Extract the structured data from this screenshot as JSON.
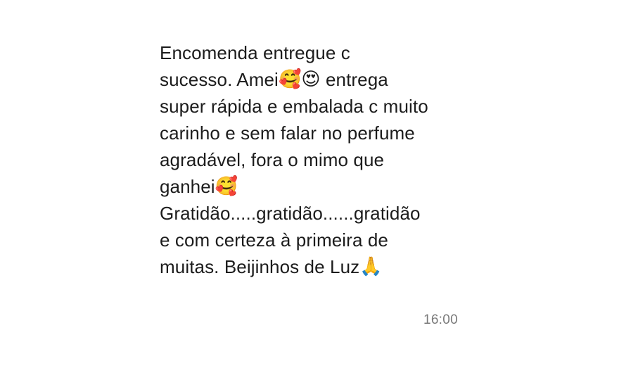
{
  "message": {
    "lines": [
      {
        "text": "Encomenda entregue c",
        "emojis": []
      },
      {
        "text": "sucesso. Amei",
        "emojis": [
          "🥰",
          "😍"
        ],
        "suffix": " entrega"
      },
      {
        "text": "super rápida e embalada c muito",
        "emojis": []
      },
      {
        "text": "carinho e sem falar no perfume",
        "emojis": []
      },
      {
        "text": "agradável, fora o mimo que",
        "emojis": []
      },
      {
        "text": "ganhei",
        "emojis": [
          "🥰"
        ]
      },
      {
        "text": "Gratidão.....gratidão......gratidão",
        "emojis": []
      },
      {
        "text": "e com certeza à primeira de",
        "emojis": []
      },
      {
        "text": "muitas. Beijinhos de Luz",
        "emojis": [
          "🙏"
        ]
      }
    ],
    "emoji_names": {
      "🥰": "smiling-face-with-hearts-icon",
      "😍": "heart-eyes-icon",
      "🙏": "folded-hands-icon"
    },
    "time": "16:00"
  }
}
